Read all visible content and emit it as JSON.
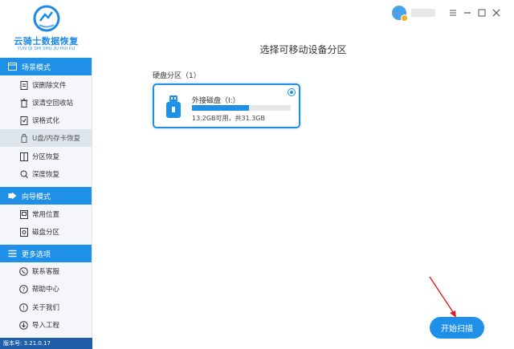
{
  "app": {
    "name": "云骑士数据恢复",
    "name_pinyin": "YUN QI SHI SHU JU HUI FU",
    "version": "版本号: 3.21.0.17"
  },
  "sidebar": {
    "sections": [
      {
        "title": "场景模式",
        "icon": "scenario-icon",
        "items": [
          {
            "label": "误删除文件",
            "icon": "file-delete-icon"
          },
          {
            "label": "误清空回收站",
            "icon": "recycle-bin-icon"
          },
          {
            "label": "误格式化",
            "icon": "format-icon"
          },
          {
            "label": "U盘/内存卡恢复",
            "icon": "usb-card-icon",
            "active": true
          },
          {
            "label": "分区恢复",
            "icon": "partition-icon"
          },
          {
            "label": "深度恢复",
            "icon": "deep-scan-icon"
          }
        ]
      },
      {
        "title": "向导模式",
        "icon": "wizard-icon",
        "items": [
          {
            "label": "常用位置",
            "icon": "location-icon"
          },
          {
            "label": "磁盘分区",
            "icon": "disk-icon"
          }
        ]
      },
      {
        "title": "更多选项",
        "icon": "menu-icon",
        "items": [
          {
            "label": "联系客服",
            "icon": "support-icon"
          },
          {
            "label": "帮助中心",
            "icon": "help-icon"
          },
          {
            "label": "关于我们",
            "icon": "info-icon"
          },
          {
            "label": "导入工程",
            "icon": "import-icon"
          }
        ]
      }
    ]
  },
  "main": {
    "title": "选择可移动设备分区",
    "section_label": "硬盘分区（1）",
    "disk": {
      "name": "外接磁盘（I:）",
      "size_text": "13.2GB可用，共31.3GB",
      "used_fraction": 0.58,
      "selected": true
    },
    "start_button": "开始扫描"
  },
  "colors": {
    "accent": "#1e90e8",
    "version_bar": "#1e5fa8",
    "annotation_arrow": "#e02020"
  }
}
